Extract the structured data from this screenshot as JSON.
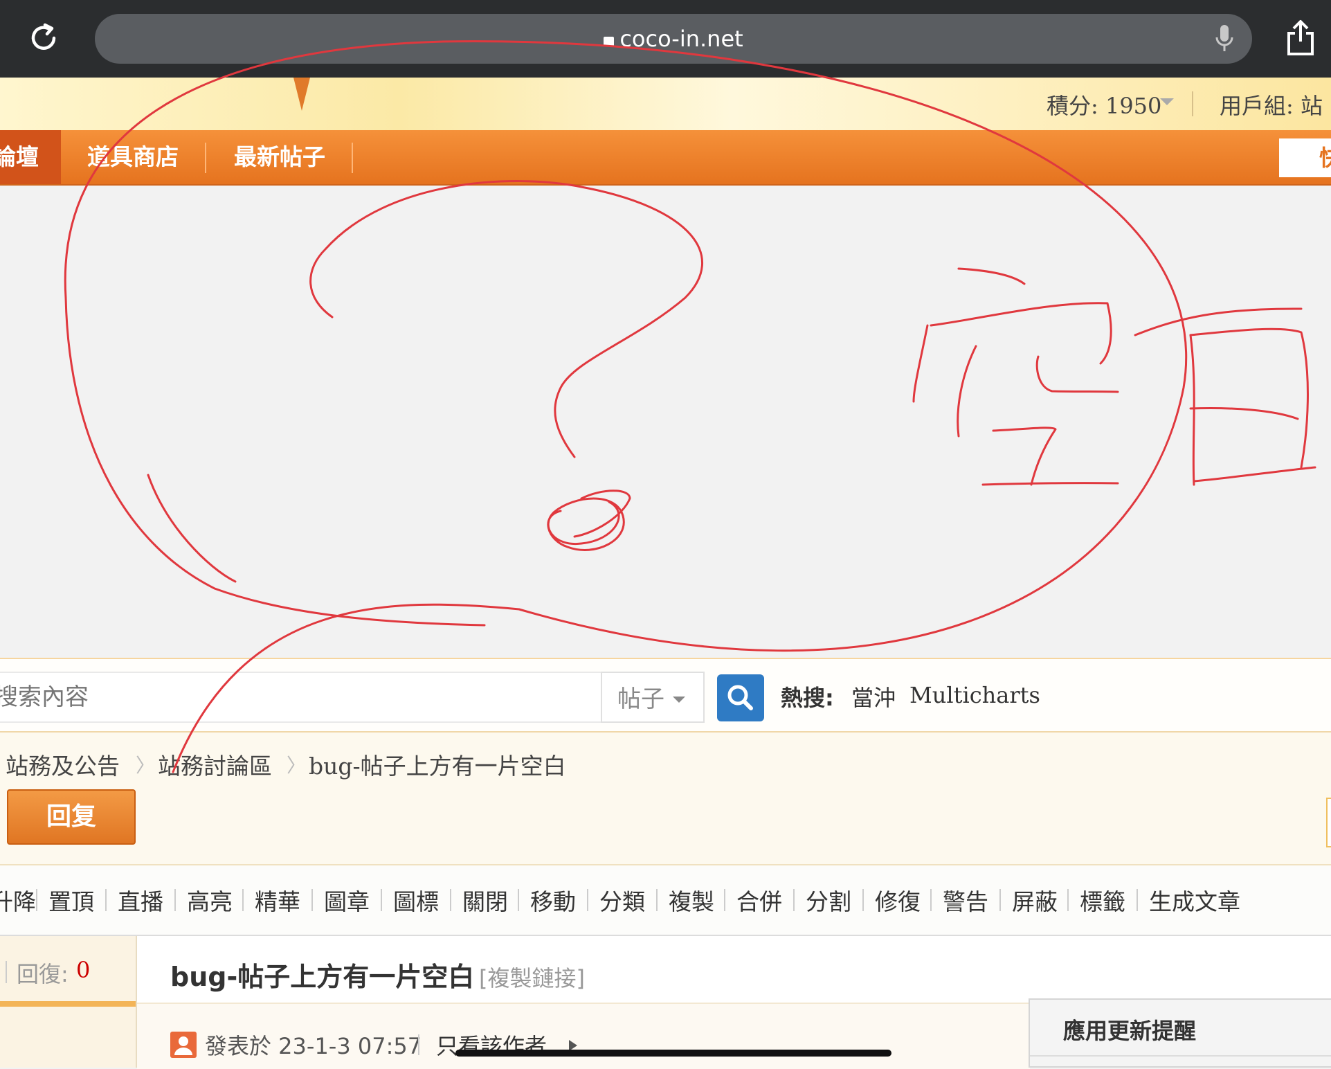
{
  "browser": {
    "url": "coco-in.net"
  },
  "header": {
    "points": "積分: 1950",
    "user_group": "用戶組: 站"
  },
  "nav": {
    "items": [
      "論壇",
      "道具商店",
      "最新帖子"
    ],
    "quick": "快"
  },
  "annotation": {
    "text": "空白",
    "color": "#e0383e"
  },
  "search": {
    "placeholder": "搜索內容",
    "type_selected": "帖子",
    "hot_label": "熱搜:",
    "hot_terms": [
      "當沖",
      "Multicharts"
    ]
  },
  "breadcrumb": [
    "站務及公告",
    "站務討論區",
    "bug-帖子上方有一片空白"
  ],
  "reply_button": "回复",
  "mod_actions": [
    "升降",
    "置頂",
    "直播",
    "高亮",
    "精華",
    "圖章",
    "圖標",
    "關閉",
    "移動",
    "分類",
    "複製",
    "合併",
    "分割",
    "修復",
    "警告",
    "屏蔽",
    "標籤",
    "生成文章"
  ],
  "thread": {
    "reply_label": "回復:",
    "reply_count": "0",
    "title": "bug-帖子上方有一片空白",
    "copy_link": "[複製鏈接]",
    "posted": "發表於 23-1-3 07:57",
    "author_only": "只看該作者"
  },
  "update_notice": {
    "title": "應用更新提醒"
  },
  "colors": {
    "nav_orange": "#e5731f",
    "search_blue": "#2f7bc4",
    "annotation_red": "#e0383e"
  }
}
